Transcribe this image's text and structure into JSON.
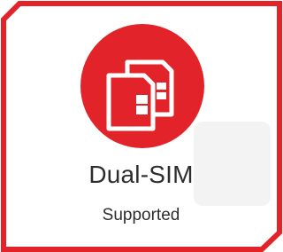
{
  "feature": {
    "title": "Dual-SIM",
    "subtitle": "Supported",
    "icon": "dual-sim-icon",
    "accent_color": "#e2232a"
  }
}
